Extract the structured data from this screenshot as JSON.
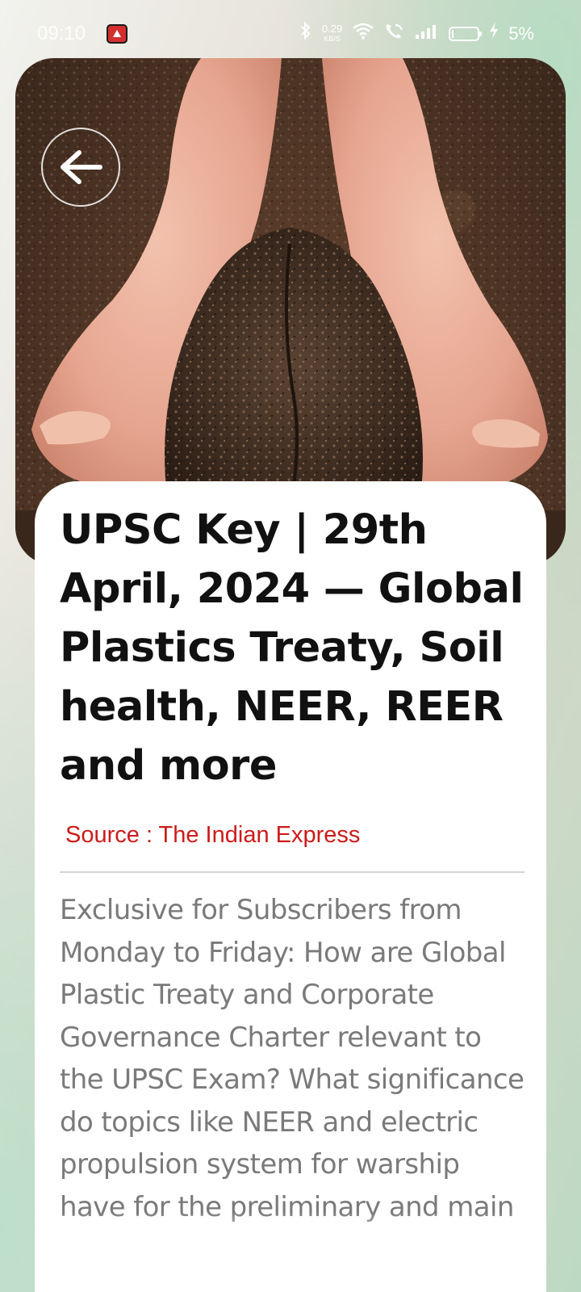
{
  "status_bar": {
    "time": "09:10",
    "app_icon": "youtube-red-icon",
    "network_speed_value": "0.29",
    "network_speed_unit": "KB/S",
    "icons": [
      "bluetooth-icon",
      "wifi-icon",
      "wifi-calling-icon",
      "signal-icon",
      "battery-icon",
      "charging-icon"
    ],
    "battery_level_percent": 5,
    "battery_percent": "5%"
  },
  "hero": {
    "image_icon": "soil-in-hands-image",
    "back_icon": "arrow-left-icon"
  },
  "article": {
    "title": "UPSC Key | 29th April, 2024 — Global Plastics Treaty, Soil health, NEER, REER and more",
    "source": "Source : The Indian Express",
    "summary": "Exclusive for Subscribers from Monday to Friday: How are Global Plastic Treaty and Corporate Governance Charter relevant to the UPSC Exam? What significance do topics like NEER and electric propulsion system for warship have for the preliminary and main exams"
  },
  "colors": {
    "source_red": "#cc1b1b",
    "title": "#111111",
    "summary": "#7a7a7a",
    "card_bg": "#ffffff"
  }
}
